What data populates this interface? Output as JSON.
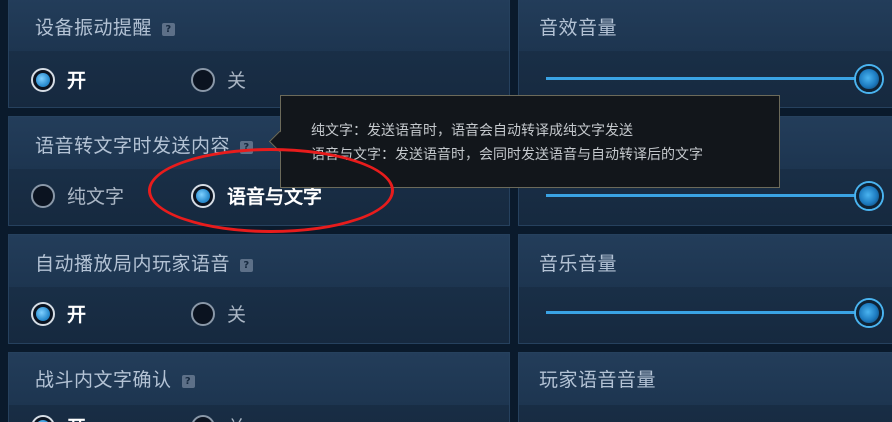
{
  "left_settings": [
    {
      "title": "设备振动提醒",
      "has_help": true,
      "options": [
        {
          "label": "开",
          "selected": true
        },
        {
          "label": "关",
          "selected": false
        }
      ]
    },
    {
      "title": "语音转文字时发送内容",
      "has_help": true,
      "options": [
        {
          "label": "纯文字",
          "selected": false
        },
        {
          "label": "语音与文字",
          "selected": true
        }
      ]
    },
    {
      "title": "自动播放局内玩家语音",
      "has_help": true,
      "options": [
        {
          "label": "开",
          "selected": true
        },
        {
          "label": "关",
          "selected": false
        }
      ]
    },
    {
      "title": "战斗内文字确认",
      "has_help": true,
      "options": [
        {
          "label": "开",
          "selected": true
        },
        {
          "label": "关",
          "selected": false
        }
      ]
    }
  ],
  "right_settings": [
    {
      "title": "音效音量",
      "level": 1.0
    },
    {
      "title": "",
      "level": 1.0
    },
    {
      "title": "音乐音量",
      "level": 1.0
    },
    {
      "title": "玩家语音音量",
      "level": null
    }
  ],
  "help_glyph": "?",
  "tooltip": {
    "line1": "纯文字：发送语音时，语音会自动转译成纯文字发送",
    "line2": "语音与文字：发送语音时，会同时发送语音与自动转译后的文字"
  },
  "colors": {
    "accent": "#3aa3e4",
    "annotation": "#e81c1c",
    "panel": "#1c344e"
  }
}
